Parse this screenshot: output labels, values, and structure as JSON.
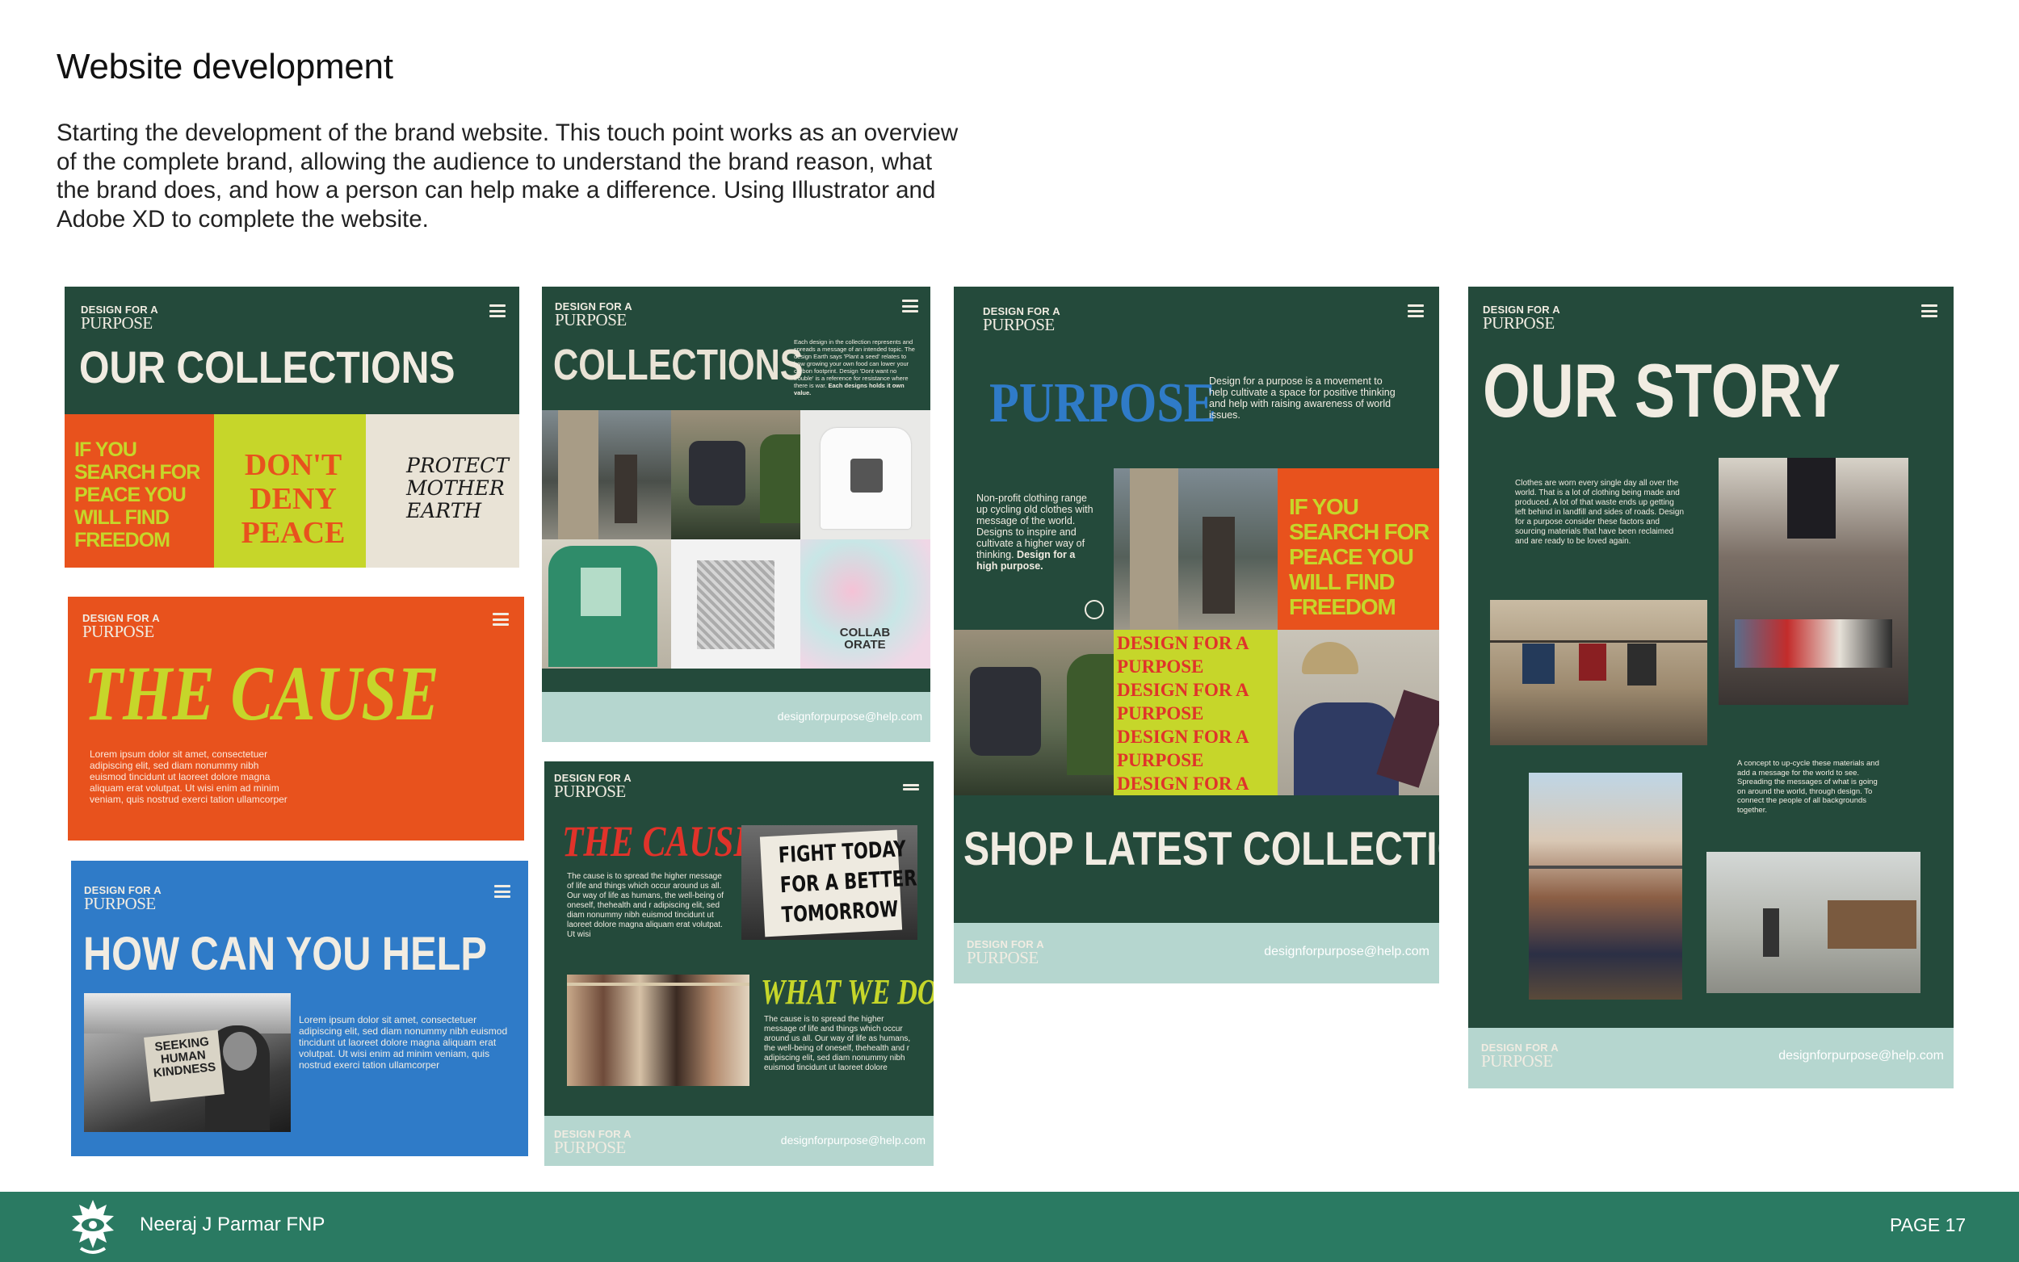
{
  "page": {
    "title": "Website development",
    "intro": "Starting the development of the brand website. This touch point works as an overview of the complete brand, allowing the audience to understand the brand reason, what the brand does, and how a person can help make a difference. Using Illustrator and Adobe XD to complete the website."
  },
  "brand": {
    "logo_line1": "DESIGN FOR A",
    "logo_line2": "PURPOSE",
    "email": "designforpurpose@help.com"
  },
  "colors": {
    "dark_green": "#244a3b",
    "orange": "#e8521d",
    "lime": "#c6d62a",
    "cream": "#e9e3d6",
    "blue": "#2f7bc8",
    "mint": "#b5d6cf",
    "footer": "#2a7a62"
  },
  "card1": {
    "heading": "OUR COLLECTIONS",
    "tile1": "IF YOU SEARCH FOR PEACE YOU WILL FIND FREEDOM",
    "tile2": "DON'T DENY PEACE",
    "tile3": "PROTECT MOTHER EARTH"
  },
  "card2": {
    "heading": "THE CAUSE",
    "body": "Lorem ipsum dolor sit amet, consectetuer adipiscing elit, sed diam nonummy nibh euismod tincidunt ut laoreet dolore magna aliquam erat volutpat. Ut wisi enim ad minim veniam, quis nostrud exerci tation ullamcorper"
  },
  "card3": {
    "heading": "HOW CAN YOU HELP",
    "sign": "SEEKING HUMAN KINDNESS",
    "body": "Lorem ipsum dolor sit amet, consectetuer adipiscing elit, sed diam nonummy nibh euismod tincidunt ut laoreet dolore magna aliquam erat volutpat. Ut wisi enim ad minim veniam, quis nostrud exerci tation ullamcorper"
  },
  "card4": {
    "heading": "COLLECTIONS",
    "desc": "Each design in the collection represents and spreads a message of an intended topic. The design Earth says 'Plant a seed' relates to how growing your own food can lower your carbon footprint. Design 'Dont want no trouble' is a reference for resistance where there is war.",
    "desc_bold": "Each designs holds it own value.",
    "shirt_text": "COLLAB ORATE"
  },
  "card5": {
    "cause_heading": "THE CAUSE",
    "cause_body": "The cause is to spread the higher message of life and things which occur around us all. Our way of life as humans, the well-being of oneself, thehealth and r adipiscing elit, sed diam nonummy nibh euismod tincidunt ut laoreet dolore magna aliquam erat volutpat. Ut wisi",
    "sign": [
      "FIGHT TODAY",
      "FOR A BETTER",
      "TOMORROW"
    ],
    "what_heading": "WHAT WE DO",
    "what_body": "The cause is to spread the higher message of life and things which occur around us all. Our way of life as humans, the well-being of oneself, thehealth and r adipiscing elit, sed diam nonummy nibh euismod tincidunt ut laoreet dolore"
  },
  "card6": {
    "heading": "PURPOSE",
    "desc": "Design for a purpose is a movement to help cultivate a space for positive thinking and help with raising awareness of world issues.",
    "side_text": "Non-profit clothing range up cycling old clothes with message of the world. Designs to inspire and cultivate a higher way of thinking.",
    "side_bold": "Design for a high purpose.",
    "tile": "IF YOU SEARCH FOR PEACE YOU WILL FIND FREEDOM",
    "purpose_repeat": "DESIGN FOR A PURPOSE",
    "shop_heading": "SHOP LATEST COLLECTIONS"
  },
  "card7": {
    "heading": "OUR STORY",
    "text1": "Clothes are worn every single day all over the world. That is a lot of clothing being made and produced. A lot of that waste ends up getting left behind in landfill and sides of roads. Design for a purpose consider these factors and sourcing materials that have been reclaimed and are ready to be loved again.",
    "text2": "A concept to up-cycle these materials and add a message for the world to see. Spreading the messages of what is going on around the world, through design. To connect the people of all backgrounds together."
  },
  "footer": {
    "author": "Neeraj J Parmar FNP",
    "page": "PAGE 17"
  }
}
